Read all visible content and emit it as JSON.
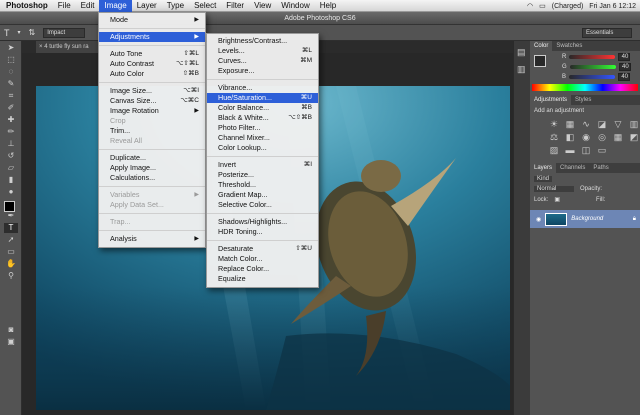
{
  "menubar": {
    "items": [
      "Photoshop",
      "File",
      "Edit",
      "Image",
      "Layer",
      "Type",
      "Select",
      "Filter",
      "View",
      "Window",
      "Help"
    ],
    "active": "Image",
    "battery": "(Charged)",
    "clock": "Fri Jan 6  12:12"
  },
  "titlebar": {
    "title": "Adobe Photoshop CS6"
  },
  "options": {
    "font_field": "Impact",
    "workspace": "Essentials"
  },
  "document": {
    "tab": "4 turtle fly sun ra"
  },
  "image_menu": {
    "items": [
      {
        "label": "Mode",
        "shortcut": "",
        "submenu": true,
        "disabled": false,
        "sep_after": true
      },
      {
        "label": "Adjustments",
        "shortcut": "",
        "submenu": true,
        "disabled": false,
        "highlighted": true,
        "sep_after": true
      },
      {
        "label": "Auto Tone",
        "shortcut": "⇧⌘L",
        "disabled": false
      },
      {
        "label": "Auto Contrast",
        "shortcut": "⌥⇧⌘L",
        "disabled": false
      },
      {
        "label": "Auto Color",
        "shortcut": "⇧⌘B",
        "disabled": false,
        "sep_after": true
      },
      {
        "label": "Image Size...",
        "shortcut": "⌥⌘I",
        "disabled": false
      },
      {
        "label": "Canvas Size...",
        "shortcut": "⌥⌘C",
        "disabled": false
      },
      {
        "label": "Image Rotation",
        "shortcut": "",
        "submenu": true,
        "disabled": false
      },
      {
        "label": "Crop",
        "shortcut": "",
        "disabled": true
      },
      {
        "label": "Trim...",
        "shortcut": "",
        "disabled": false
      },
      {
        "label": "Reveal All",
        "shortcut": "",
        "disabled": true,
        "sep_after": true
      },
      {
        "label": "Duplicate...",
        "shortcut": "",
        "disabled": false
      },
      {
        "label": "Apply Image...",
        "shortcut": "",
        "disabled": false
      },
      {
        "label": "Calculations...",
        "shortcut": "",
        "disabled": false,
        "sep_after": true
      },
      {
        "label": "Variables",
        "shortcut": "",
        "submenu": true,
        "disabled": true
      },
      {
        "label": "Apply Data Set...",
        "shortcut": "",
        "disabled": true,
        "sep_after": true
      },
      {
        "label": "Trap...",
        "shortcut": "",
        "disabled": true,
        "sep_after": true
      },
      {
        "label": "Analysis",
        "shortcut": "",
        "submenu": true,
        "disabled": false
      }
    ]
  },
  "adjust_menu": {
    "items": [
      {
        "label": "Brightness/Contrast...",
        "shortcut": ""
      },
      {
        "label": "Levels...",
        "shortcut": "⌘L"
      },
      {
        "label": "Curves...",
        "shortcut": "⌘M"
      },
      {
        "label": "Exposure...",
        "shortcut": "",
        "sep_after": true
      },
      {
        "label": "Vibrance...",
        "shortcut": ""
      },
      {
        "label": "Hue/Saturation...",
        "shortcut": "⌘U",
        "highlighted": true
      },
      {
        "label": "Color Balance...",
        "shortcut": "⌘B"
      },
      {
        "label": "Black & White...",
        "shortcut": "⌥⇧⌘B"
      },
      {
        "label": "Photo Filter...",
        "shortcut": ""
      },
      {
        "label": "Channel Mixer...",
        "shortcut": ""
      },
      {
        "label": "Color Lookup...",
        "shortcut": "",
        "sep_after": true
      },
      {
        "label": "Invert",
        "shortcut": "⌘I"
      },
      {
        "label": "Posterize...",
        "shortcut": ""
      },
      {
        "label": "Threshold...",
        "shortcut": ""
      },
      {
        "label": "Gradient Map...",
        "shortcut": ""
      },
      {
        "label": "Selective Color...",
        "shortcut": "",
        "sep_after": true
      },
      {
        "label": "Shadows/Highlights...",
        "shortcut": ""
      },
      {
        "label": "HDR Toning...",
        "shortcut": "",
        "sep_after": true
      },
      {
        "label": "Desaturate",
        "shortcut": "⇧⌘U"
      },
      {
        "label": "Match Color...",
        "shortcut": ""
      },
      {
        "label": "Replace Color...",
        "shortcut": ""
      },
      {
        "label": "Equalize",
        "shortcut": ""
      }
    ]
  },
  "color_panel": {
    "tabs": [
      "Color",
      "Swatches"
    ],
    "sliders": [
      {
        "label": "R",
        "value": "40",
        "color": "#e04040"
      },
      {
        "label": "G",
        "value": "40",
        "color": "#40c040"
      },
      {
        "label": "B",
        "value": "40",
        "color": "#4060e0"
      }
    ]
  },
  "adjustments_panel": {
    "tabs": [
      "Adjustments",
      "Styles"
    ],
    "heading": "Add an adjustment"
  },
  "layers_panel": {
    "tabs": [
      "Layers",
      "Channels",
      "Paths"
    ],
    "kind": "Kind",
    "blend": "Normal",
    "opacity_label": "Opacity:",
    "lock_label": "Lock:",
    "fill_label": "Fill:",
    "layer_name": "Background"
  }
}
